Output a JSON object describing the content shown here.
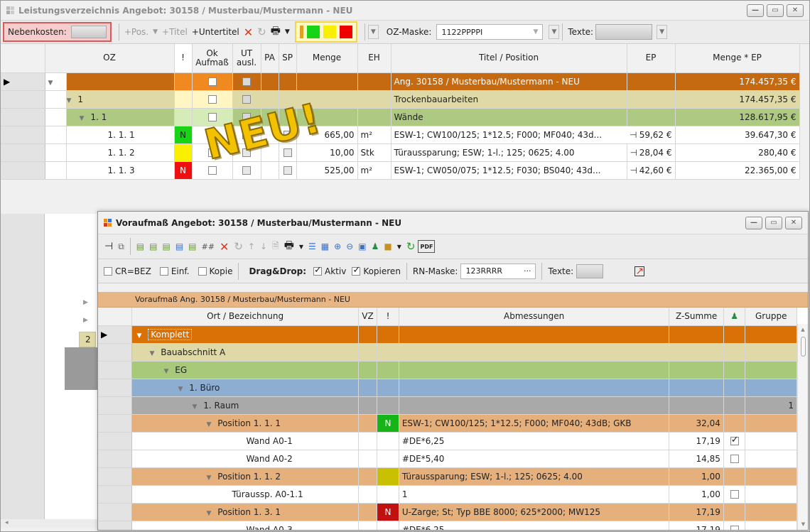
{
  "main": {
    "title": "Leistungsverzeichnis Angebot: 30158 / Musterbau/Mustermann - NEU",
    "toolbar": {
      "nebenkosten_label": "Nebenkosten:",
      "pos": "+Pos.",
      "titel": "+Titel",
      "untertitel": "+Untertitel",
      "oz_maske_label": "OZ-Maske:",
      "oz_maske_value": "1122PPPPI",
      "texte_label": "Texte:"
    },
    "columns": [
      "OZ",
      "!",
      "Ok Aufmaß",
      "UT ausl.",
      "PA",
      "SP",
      "Menge",
      "EH",
      "Titel / Position",
      "EP",
      "Menge * EP"
    ],
    "rows": [
      {
        "oz": "",
        "titel": "Ang. 30158 / Musterbau/Mustermann - NEU",
        "total": "174.457,35 €"
      },
      {
        "oz": "1",
        "titel": "Trockenbauarbeiten",
        "total": "174.457,35 €"
      },
      {
        "oz": "1. 1",
        "titel": "Wände",
        "total": "128.617,95 €"
      },
      {
        "oz": "1. 1. 1",
        "flag": "N",
        "menge": "665,00",
        "eh": "m²",
        "titel": "ESW-1; CW100/125; 1*12.5; F000; MF040; 43d...",
        "ep": "59,62 €",
        "total": "39.647,30 €"
      },
      {
        "oz": "1. 1. 2",
        "flag": "",
        "menge": "10,00",
        "eh": "Stk",
        "titel": "Türaussparung; ESW; 1-l.; 125; 0625; 4.00",
        "ep": "28,04 €",
        "total": "280,40 €"
      },
      {
        "oz": "1. 1. 3",
        "flag": "N",
        "menge": "525,00",
        "eh": "m²",
        "titel": "ESW-1; CW050/075; 1*12.5; F030; BS040; 43d...",
        "ep": "42,60 €",
        "total": "22.365,00 €"
      }
    ],
    "lower_oz_label": "2",
    "neu_stamp": "NEU!"
  },
  "sub": {
    "title": "Voraufmaß Angebot: 30158 / Musterbau/Mustermann - NEU",
    "toolbar2": {
      "cr_bez": "CR=BEZ",
      "einf": "Einf.",
      "kopie": "Kopie",
      "dragdrop": "Drag&Drop:",
      "aktiv": "Aktiv",
      "kopieren": "Kopieren",
      "rn_maske_label": "RN-Maske:",
      "rn_maske_value": "123RRRR",
      "rn_dots": "···",
      "texte_label": "Texte:"
    },
    "banner": "Voraufmaß Ang. 30158 / Musterbau/Mustermann - NEU",
    "columns": [
      "Ort / Bezeichnung",
      "VZ",
      "!",
      "Abmessungen",
      "Z-Summe",
      "",
      "Gruppe"
    ],
    "rows": [
      {
        "name": "Komplett",
        "abm": "",
        "zsum": "",
        "gruppe": ""
      },
      {
        "name": "Bauabschnitt A",
        "abm": "",
        "zsum": "",
        "gruppe": ""
      },
      {
        "name": "EG",
        "abm": "",
        "zsum": "",
        "gruppe": ""
      },
      {
        "name": "1. Büro",
        "abm": "",
        "zsum": "",
        "gruppe": ""
      },
      {
        "name": "1. Raum",
        "abm": "",
        "zsum": "",
        "gruppe": "1"
      },
      {
        "name": "Position  1. 1.  1",
        "flag": "N",
        "abm": "ESW-1; CW100/125; 1*12.5; F000; MF040; 43dB; GKB",
        "zsum": "32,04",
        "gruppe": ""
      },
      {
        "name": "Wand A0-1",
        "abm": "#DE*6,25",
        "zsum": "17,19",
        "gruppe": ""
      },
      {
        "name": "Wand A0-2",
        "abm": "#DE*5,40",
        "zsum": "14,85",
        "gruppe": ""
      },
      {
        "name": "Position  1. 1.  2",
        "flag": "",
        "abm": "Türaussparung; ESW; 1-l.; 125; 0625; 4.00",
        "zsum": "1,00",
        "gruppe": ""
      },
      {
        "name": "Türaussp. A0-1.1",
        "abm": "1",
        "zsum": "1,00",
        "gruppe": ""
      },
      {
        "name": "Position  1. 3.  1",
        "flag": "N",
        "abm": "U-Zarge; St; Typ BBE 8000; 625*2000; MW125",
        "zsum": "17,19",
        "gruppe": ""
      },
      {
        "name": "Wand A0-3",
        "abm": "#DE*6,25",
        "zsum": "17,19",
        "gruppe": ""
      }
    ]
  },
  "colors": {
    "orange": "#d97106",
    "khaki": "#dfd9a8",
    "green": "#a9c97a",
    "blue": "#8daed0",
    "gray": "#a9a9a9",
    "salmon": "#e6b07c",
    "flag_green": "#17b417",
    "flag_yellow": "#f0e010",
    "flag_red": "#e81010",
    "flag_olive": "#c8c000"
  }
}
